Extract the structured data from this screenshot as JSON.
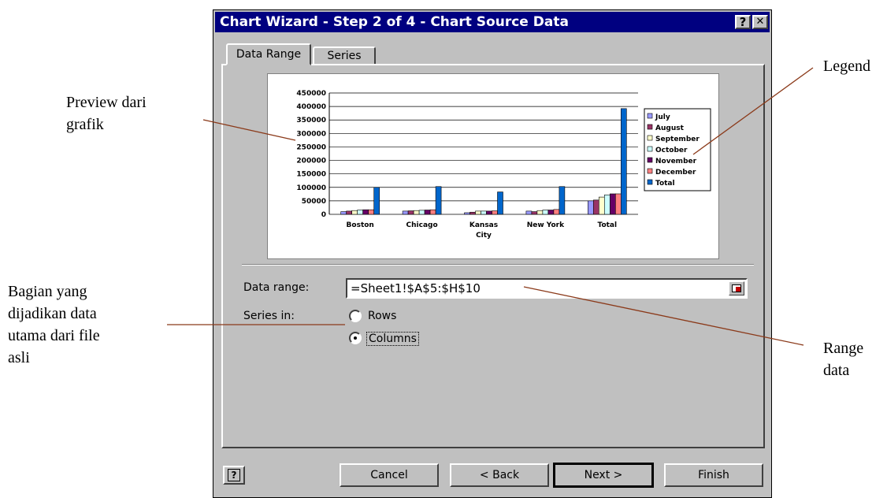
{
  "window": {
    "title": "Chart Wizard - Step 2 of 4 - Chart Source Data",
    "help_button": "?",
    "close_button": "✕"
  },
  "tabs": [
    {
      "label": "Data Range",
      "active": true
    },
    {
      "label": "Series",
      "active": false
    }
  ],
  "form": {
    "data_range_label": "Data range:",
    "data_range_value": "=Sheet1!$A$5:$H$10",
    "series_in_label": "Series in:",
    "options": [
      {
        "label": "Rows",
        "selected": false
      },
      {
        "label": "Columns",
        "selected": true
      }
    ]
  },
  "buttons": {
    "cancel": "Cancel",
    "back": "< Back",
    "next": "Next >",
    "finish": "Finish"
  },
  "annotations": {
    "preview": [
      "Preview dari",
      "grafik"
    ],
    "legend": [
      "Legend"
    ],
    "main_data": [
      "Bagian yang",
      "dijadikan data",
      "utama dari file",
      "asli"
    ],
    "range": [
      "Range",
      "data"
    ]
  },
  "chart_data": {
    "type": "bar",
    "categories": [
      "Boston",
      "Chicago",
      "Kansas City",
      "New York",
      "Total"
    ],
    "series": [
      {
        "name": "July",
        "color": "#9999ff",
        "values": [
          10000,
          12000,
          6000,
          12000,
          50000
        ]
      },
      {
        "name": "August",
        "color": "#993366",
        "values": [
          12000,
          13000,
          8000,
          10000,
          53000
        ]
      },
      {
        "name": "September",
        "color": "#ffffcc",
        "values": [
          14000,
          14000,
          12000,
          14000,
          64000
        ]
      },
      {
        "name": "October",
        "color": "#ccffff",
        "values": [
          16000,
          15000,
          12000,
          16000,
          72000
        ]
      },
      {
        "name": "November",
        "color": "#660066",
        "values": [
          17000,
          16000,
          12000,
          16000,
          76000
        ]
      },
      {
        "name": "December",
        "color": "#ff8080",
        "values": [
          17000,
          17000,
          13000,
          18000,
          76000
        ]
      },
      {
        "name": "Total",
        "color": "#0066cc",
        "values": [
          100000,
          103000,
          83000,
          103000,
          392000
        ]
      }
    ],
    "ylim": [
      0,
      450000
    ],
    "yticks": [
      "450000",
      "400000",
      "350000",
      "300000",
      "250000",
      "200000",
      "150000",
      "100000",
      "50000",
      "0"
    ],
    "grid": true,
    "legend": "right"
  }
}
